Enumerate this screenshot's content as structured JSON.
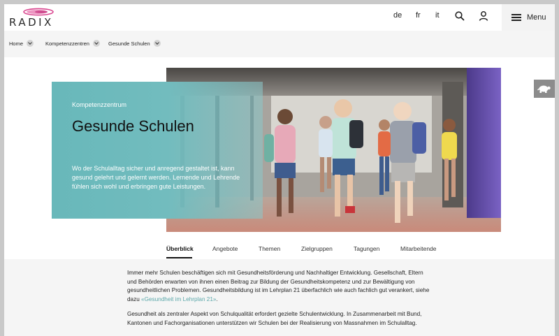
{
  "header": {
    "logo_text": "RADIX",
    "languages": [
      "de",
      "fr",
      "it"
    ],
    "menu_label": "Menu",
    "icons": {
      "search": "search-icon",
      "user": "user-icon",
      "menu": "hamburger-icon"
    },
    "brand_color": "#d9458f"
  },
  "breadcrumb": {
    "items": [
      {
        "label": "Home"
      },
      {
        "label": "Kompetenzzentren"
      },
      {
        "label": "Gesunde Schulen"
      }
    ]
  },
  "hero": {
    "eyebrow": "Kompetenzzentrum",
    "title": "Gesunde Schulen",
    "lead": "Wo der Schulalltag sicher und anregend gestaltet ist, kann gesund gelehrt und gelernt werden. Lernende und Lehrende fühlen sich wohl und erbringen gute Leistungen.",
    "panel_color": "#6ab8ba"
  },
  "side_tab": {
    "icon": "turtle-icon"
  },
  "tabs": {
    "items": [
      {
        "label": "Überblick",
        "active": true
      },
      {
        "label": "Angebote"
      },
      {
        "label": "Themen"
      },
      {
        "label": "Zielgruppen"
      },
      {
        "label": "Tagungen"
      },
      {
        "label": "Mitarbeitende"
      }
    ]
  },
  "content": {
    "p1_text": "Immer mehr Schulen beschäftigen sich mit Gesundheitsförderung und Nachhaltiger Entwicklung. Gesellschaft, Eltern und Behörden erwarten von ihnen einen Beitrag zur Bildung der Gesundheitskompetenz und zur Bewältigung von gesundheitlichen Problemen. Gesundheitsbildung ist im Lehrplan 21 überfachlich wie auch fachlich gut verankert, siehe dazu ",
    "p1_link": "«Gesundheit im Lehrplan 21»",
    "p1_end": ".",
    "p2_text": "Gesundheit als zentraler Aspekt von Schulqualität erfordert gezielte Schulentwicklung. In Zusammenarbeit mit Bund, Kantonen und Fachorganisationen unterstützen wir Schulen bei der Realisierung von Massnahmen im Schulalltag.",
    "link_color": "#5aa7a9"
  }
}
